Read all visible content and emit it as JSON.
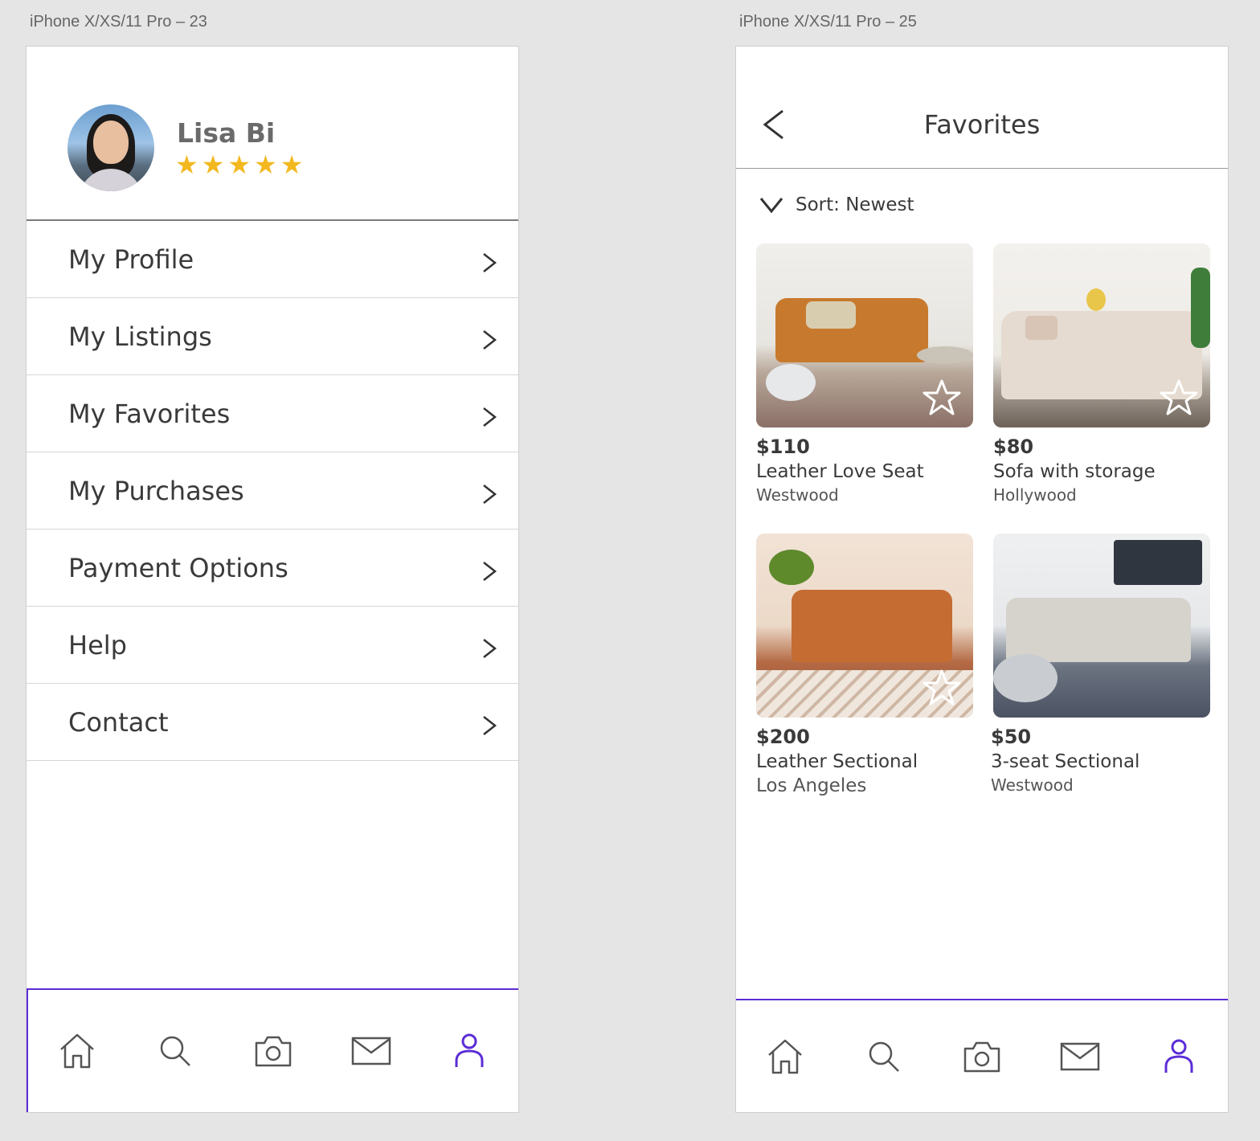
{
  "artboards": [
    {
      "label": "iPhone X/XS/11 Pro – 23"
    },
    {
      "label": "iPhone X/XS/11 Pro – 25"
    }
  ],
  "profile": {
    "name": "Lisa Bi",
    "rating": 5,
    "menu": [
      {
        "label": "My Profile"
      },
      {
        "label": "My Listings"
      },
      {
        "label": "My Favorites"
      },
      {
        "label": "My Purchases"
      },
      {
        "label": "Payment Options"
      },
      {
        "label": "Help"
      },
      {
        "label": "Contact"
      }
    ]
  },
  "favorites": {
    "title": "Favorites",
    "sort_label": "Sort: Newest",
    "items": [
      {
        "price": "$110",
        "title": "Leather Love Seat",
        "location": "Westwood"
      },
      {
        "price": "$80",
        "title": "Sofa with storage",
        "location": "Hollywood"
      },
      {
        "price": "$200",
        "title": "Leather Sectional",
        "location": "Los Angeles"
      },
      {
        "price": "$50",
        "title": "3-seat Sectional",
        "location": "Westwood"
      }
    ]
  },
  "tabbar": {
    "items": [
      "home-icon",
      "search-icon",
      "camera-icon",
      "mail-icon",
      "profile-icon"
    ],
    "active": "profile-icon",
    "active_color": "#5b2cd6",
    "inactive_color": "#555555"
  },
  "colors": {
    "star": "#f3b81f",
    "accent": "#5b2cd6"
  }
}
